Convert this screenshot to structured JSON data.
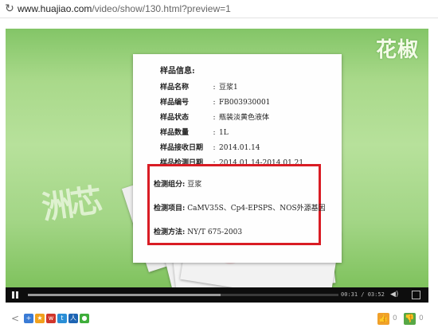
{
  "browser": {
    "url_host": "www.huajiao.com",
    "url_path": "/video/show/130.html?preview=1"
  },
  "video": {
    "watermark_top": "花椒",
    "watermark_left": "洲芯",
    "document": {
      "title": "样品信息:",
      "fields": [
        {
          "label": "样品名称",
          "value": "豆浆1"
        },
        {
          "label": "样品编号",
          "value": "FB003930001"
        },
        {
          "label": "样品状态",
          "value": "瓶装淡黄色液体"
        },
        {
          "label": "样品数量",
          "value": "1L"
        },
        {
          "label": "样品接收日期",
          "value": "2014.01.14"
        },
        {
          "label": "样品检测日期",
          "value": "2014.01.14-2014.01.21"
        }
      ],
      "highlighted": [
        {
          "label": "检测组分:",
          "value": "豆浆"
        },
        {
          "label": "检测项目:",
          "value": "CaMV35S、Cp4-EPSPS、NOS外源基因"
        },
        {
          "label": "检测方法:",
          "value": "NY/T 675-2003"
        }
      ],
      "colon": ":"
    },
    "controls": {
      "time": "00:31 / 03:52",
      "progress_fraction": 0.62
    }
  },
  "toolbar": {
    "share_icons": [
      {
        "name": "share-plus-icon",
        "glyph": "+",
        "color": "#3a7bd5"
      },
      {
        "name": "share-qzone-icon",
        "glyph": "★",
        "color": "#f2a11c"
      },
      {
        "name": "share-weibo-icon",
        "glyph": "w",
        "color": "#d0362c"
      },
      {
        "name": "share-tqq-icon",
        "glyph": "t",
        "color": "#2a8ed6"
      },
      {
        "name": "share-renren-icon",
        "glyph": "人",
        "color": "#1d64b3"
      },
      {
        "name": "share-wechat-icon",
        "glyph": "●",
        "color": "#3fae3b"
      }
    ],
    "like_count": "0",
    "dislike_count": "0"
  }
}
